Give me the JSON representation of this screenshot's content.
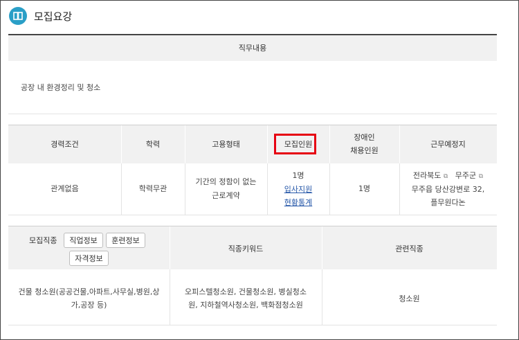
{
  "section": {
    "title": "모집요강",
    "icon": "book-icon"
  },
  "duty": {
    "header": "직무내용",
    "content": "공장 내 환경정리 및 청소"
  },
  "conditions": {
    "headers": {
      "career": "경력조건",
      "education": "학력",
      "employment": "고용형태",
      "recruit": "모집인원",
      "disabled_line1": "장애인",
      "disabled_line2": "채용인원",
      "location": "근무예정지"
    },
    "values": {
      "career": "관계없음",
      "education": "학력무관",
      "employment_line1": "기간의 정함이 없는",
      "employment_line2": "근로계약",
      "recruit_count": "1명",
      "recruit_link1": "입사지원",
      "recruit_link2": "현황통계",
      "disabled_count": "1명",
      "location_region1": "전라북도",
      "location_region2": "무주군",
      "location_line2": "무주읍 당산강변로 32,",
      "location_line3": "플무원다논"
    }
  },
  "jobs": {
    "headers": {
      "category": "모집직종",
      "keywords": "직종키워드",
      "related": "관련직종"
    },
    "buttons": {
      "job_info": "직업정보",
      "training_info": "훈련정보",
      "license_info": "자격정보"
    },
    "values": {
      "category_line1": "건물 청소원(공공건물,아파트,사무실,병원,상",
      "category_line2": "가,공장 등)",
      "keywords_line1": "오피스텔청소원, 건물청소원, 병실청소",
      "keywords_line2": "원, 지하철역사청소원, 백화점청소원",
      "related": "청소원"
    }
  }
}
